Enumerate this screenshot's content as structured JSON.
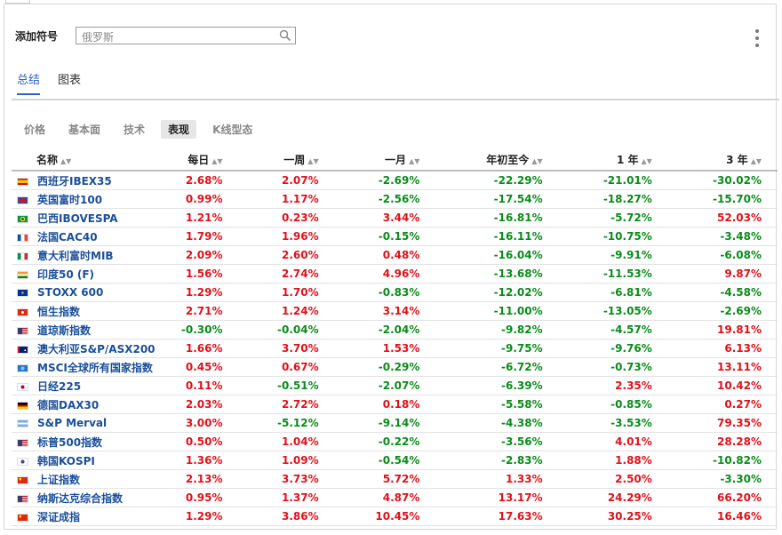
{
  "add_symbol": {
    "label": "添加符号",
    "placeholder": "俄罗斯"
  },
  "tabs": [
    {
      "label": "总结",
      "active": true
    },
    {
      "label": "图表",
      "active": false
    }
  ],
  "subtabs": [
    {
      "label": "价格",
      "active": false
    },
    {
      "label": "基本面",
      "active": false
    },
    {
      "label": "技术",
      "active": false
    },
    {
      "label": "表现",
      "active": true
    },
    {
      "label": "K线型态",
      "active": false
    }
  ],
  "columns": [
    "名称",
    "每日",
    "一周",
    "一月",
    "年初至今",
    "1 年",
    "3 年"
  ],
  "colors": {
    "positive": "#e0111b",
    "negative": "#0a8c1a",
    "link": "#1b4f9b",
    "accent": "#2962c9"
  },
  "rows": [
    {
      "flag": "es-flag-icon",
      "name": "西班牙IBEX35",
      "values": [
        "2.68%",
        "2.07%",
        "-2.69%",
        "-22.29%",
        "-21.01%",
        "-30.02%"
      ]
    },
    {
      "flag": "gb-flag-icon",
      "name": "英国富时100",
      "values": [
        "0.99%",
        "1.17%",
        "-2.56%",
        "-17.54%",
        "-18.27%",
        "-15.70%"
      ]
    },
    {
      "flag": "br-flag-icon",
      "name": "巴西IBOVESPA",
      "values": [
        "1.21%",
        "0.23%",
        "3.44%",
        "-16.81%",
        "-5.72%",
        "52.03%"
      ]
    },
    {
      "flag": "fr-flag-icon",
      "name": "法国CAC40",
      "values": [
        "1.79%",
        "1.96%",
        "-0.15%",
        "-16.11%",
        "-10.75%",
        "-3.48%"
      ]
    },
    {
      "flag": "it-flag-icon",
      "name": "意大利富时MIB",
      "values": [
        "2.09%",
        "2.60%",
        "0.48%",
        "-16.04%",
        "-9.91%",
        "-6.08%"
      ]
    },
    {
      "flag": "in-flag-icon",
      "name": "印度50 (F)",
      "values": [
        "1.56%",
        "2.74%",
        "4.96%",
        "-13.68%",
        "-11.53%",
        "9.87%"
      ]
    },
    {
      "flag": "eu-flag-icon",
      "name": "STOXX 600",
      "values": [
        "1.29%",
        "1.70%",
        "-0.83%",
        "-12.02%",
        "-6.81%",
        "-4.58%"
      ]
    },
    {
      "flag": "hk-flag-icon",
      "name": "恒生指数",
      "values": [
        "2.71%",
        "1.24%",
        "3.14%",
        "-11.00%",
        "-13.05%",
        "-2.69%"
      ]
    },
    {
      "flag": "us-flag-icon",
      "name": "道琼斯指数",
      "values": [
        "-0.30%",
        "-0.04%",
        "-2.04%",
        "-9.82%",
        "-4.57%",
        "19.81%"
      ]
    },
    {
      "flag": "au-flag-icon",
      "name": "澳大利亚S&P/ASX200",
      "values": [
        "1.66%",
        "3.70%",
        "1.53%",
        "-9.75%",
        "-9.76%",
        "6.13%"
      ]
    },
    {
      "flag": "world-flag-icon",
      "name": "MSCI全球所有国家指数",
      "values": [
        "0.45%",
        "0.67%",
        "-0.29%",
        "-6.72%",
        "-0.73%",
        "13.11%"
      ]
    },
    {
      "flag": "jp-flag-icon",
      "name": "日经225",
      "values": [
        "0.11%",
        "-0.51%",
        "-2.07%",
        "-6.39%",
        "2.35%",
        "10.42%"
      ]
    },
    {
      "flag": "de-flag-icon",
      "name": "德国DAX30",
      "values": [
        "2.03%",
        "2.72%",
        "0.18%",
        "-5.58%",
        "-0.85%",
        "0.27%"
      ]
    },
    {
      "flag": "ar-flag-icon",
      "name": "S&P Merval",
      "values": [
        "3.00%",
        "-5.12%",
        "-9.14%",
        "-4.38%",
        "-3.53%",
        "79.35%"
      ]
    },
    {
      "flag": "us-flag-icon",
      "name": "标普500指数",
      "values": [
        "0.50%",
        "1.04%",
        "-0.22%",
        "-3.56%",
        "4.01%",
        "28.28%"
      ]
    },
    {
      "flag": "kr-flag-icon",
      "name": "韩国KOSPI",
      "values": [
        "1.36%",
        "1.09%",
        "-0.54%",
        "-2.83%",
        "1.88%",
        "-10.82%"
      ]
    },
    {
      "flag": "cn-flag-icon",
      "name": "上证指数",
      "values": [
        "2.13%",
        "3.73%",
        "5.72%",
        "1.33%",
        "2.50%",
        "-3.30%"
      ]
    },
    {
      "flag": "us-flag-icon",
      "name": "纳斯达克综合指数",
      "values": [
        "0.95%",
        "1.37%",
        "4.87%",
        "13.17%",
        "24.29%",
        "66.20%"
      ]
    },
    {
      "flag": "cn-flag-icon",
      "name": "深证成指",
      "values": [
        "1.29%",
        "3.86%",
        "10.45%",
        "17.63%",
        "30.25%",
        "16.46%"
      ]
    }
  ]
}
